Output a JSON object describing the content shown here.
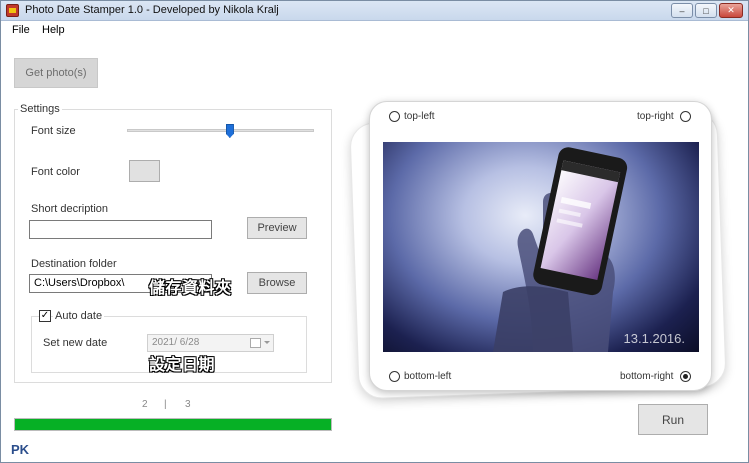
{
  "window": {
    "title": "Photo Date Stamper 1.0 - Developed by Nikola Kralj",
    "minimize_glyph": "‒",
    "maximize_glyph": "□",
    "close_glyph": "✕"
  },
  "menu": {
    "file": "File",
    "help": "Help"
  },
  "get_photos_button": "Get photo(s)",
  "settings": {
    "group_label": "Settings",
    "font_size_label": "Font size",
    "font_size_level": 0.55,
    "font_color_label": "Font color",
    "font_color_value": "#e1e1e1",
    "short_description_label": "Short decription",
    "short_description_value": "",
    "preview_button": "Preview",
    "destination_folder_label": "Destination folder",
    "destination_folder_value": "C:\\Users\\Dropbox\\",
    "browse_button": "Browse",
    "auto_date_label": "Auto date",
    "auto_date_checked": "✓",
    "set_new_date_label": "Set new date",
    "date_value": "2021/  6/28"
  },
  "annotations": {
    "folder_note": "儲存資料夾",
    "date_note": "設定日期"
  },
  "steps": {
    "left": "2",
    "separator": "|",
    "right": "3"
  },
  "progress": {
    "fraction": 1.0,
    "color": "#06b025"
  },
  "preview": {
    "top_left": "top-left",
    "top_right": "top-right",
    "bottom_left": "bottom-left",
    "bottom_right": "bottom-right",
    "selected_position": "bottom-right",
    "stamp_text": "13.1.2016."
  },
  "run_button": "Run",
  "watermark": {
    "logo": "PK",
    "sub": "..."
  }
}
